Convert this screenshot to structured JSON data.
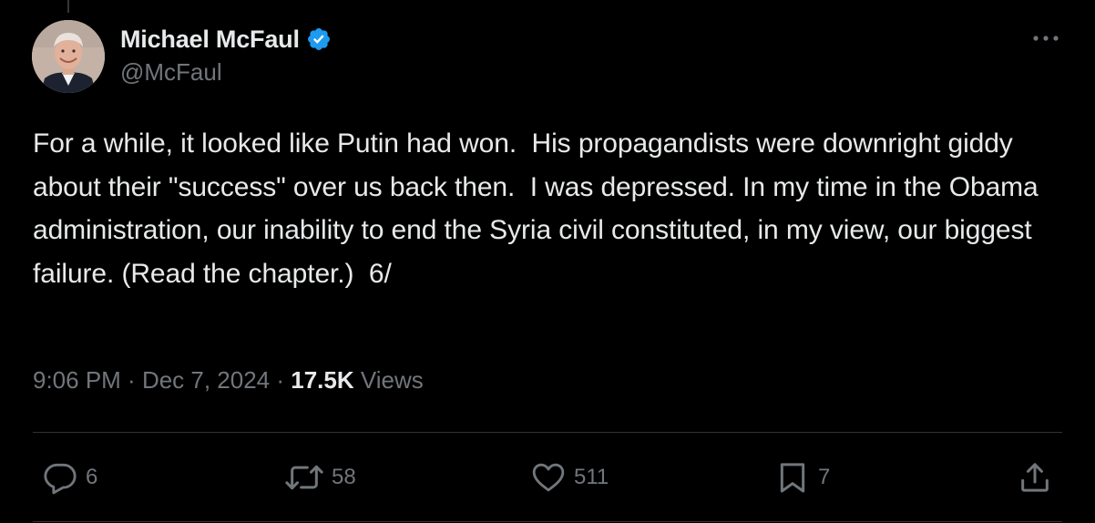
{
  "author": {
    "display_name": "Michael McFaul",
    "handle": "@McFaul",
    "verified_icon": "verified-badge-icon",
    "verified_color": "#1d9bf0"
  },
  "tweet": {
    "text": "For a while, it looked like Putin had won.  His propagandists were downright giddy about their \"success\" over us back then.  I was depressed. In my time in the Obama administration, our inability to end the Syria civil constituted, in my view, our biggest failure. (Read the chapter.)  6/",
    "time": "9:06 PM",
    "separator": " · ",
    "date": "Dec 7, 2024",
    "views_count": "17.5K",
    "views_label": " Views"
  },
  "actions": {
    "reply": {
      "icon": "reply-icon",
      "count": "6"
    },
    "retweet": {
      "icon": "retweet-icon",
      "count": "58"
    },
    "like": {
      "icon": "heart-icon",
      "count": "511"
    },
    "bookmark": {
      "icon": "bookmark-icon",
      "count": "7"
    },
    "share": {
      "icon": "share-icon"
    }
  },
  "colors": {
    "background": "#000000",
    "text_primary": "#e7e9ea",
    "text_secondary": "#71767b",
    "divider": "#2f3336"
  }
}
